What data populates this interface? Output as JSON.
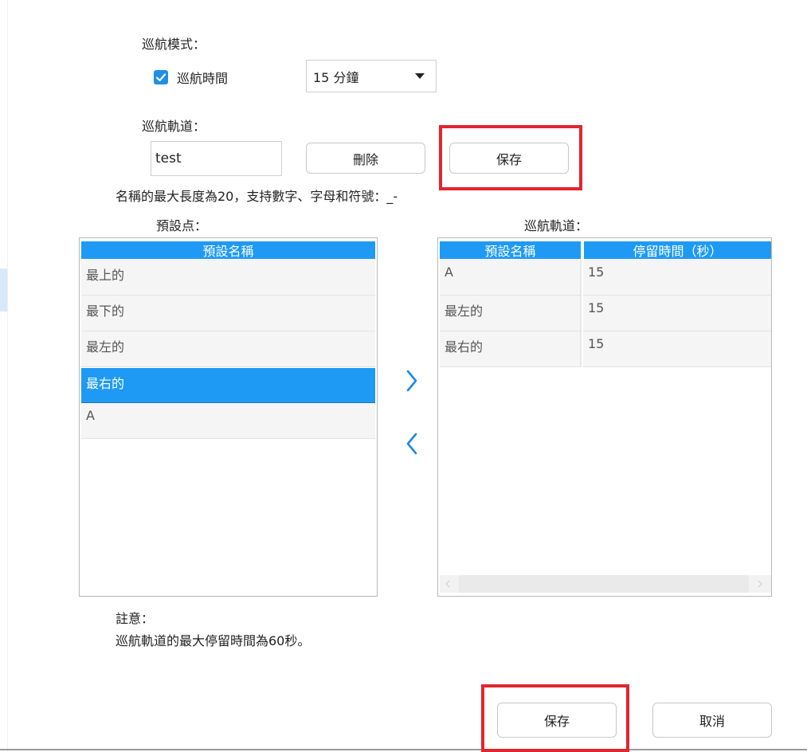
{
  "cruise_mode": {
    "label": "巡航模式：",
    "checkbox_label": "巡航時間",
    "checked": true,
    "time_select_value": "15 分鐘"
  },
  "cruise_track": {
    "label": "巡航軌道：",
    "name_value": "test",
    "delete_label": "刪除",
    "save_label": "保存",
    "hint": "名稱的最大長度為20，支持數字、字母和符號：_-"
  },
  "presets": {
    "label": "預設点：",
    "header": "預設名稱",
    "items": [
      "最上的",
      "最下的",
      "最左的",
      "最右的",
      "A"
    ],
    "selected_index": 3
  },
  "track_list": {
    "label": "巡航軌道：",
    "headers": [
      "預設名稱",
      "停留時間（秒）"
    ],
    "rows": [
      {
        "name": "A",
        "time": "15"
      },
      {
        "name": "最左的",
        "time": "15"
      },
      {
        "name": "最右的",
        "time": "15"
      }
    ]
  },
  "note": {
    "title": "註意：",
    "text": "巡航軌道的最大停留時間為60秒。"
  },
  "footer": {
    "save_label": "保存",
    "cancel_label": "取消"
  },
  "colors": {
    "accent": "#1e9af5",
    "highlight_box": "#e0262e",
    "arrow": "#1e88e5"
  },
  "icons": {
    "add": "chevron-right-icon",
    "remove": "chevron-left-icon",
    "check": "checkmark-icon",
    "dropdown": "caret-down-icon"
  }
}
